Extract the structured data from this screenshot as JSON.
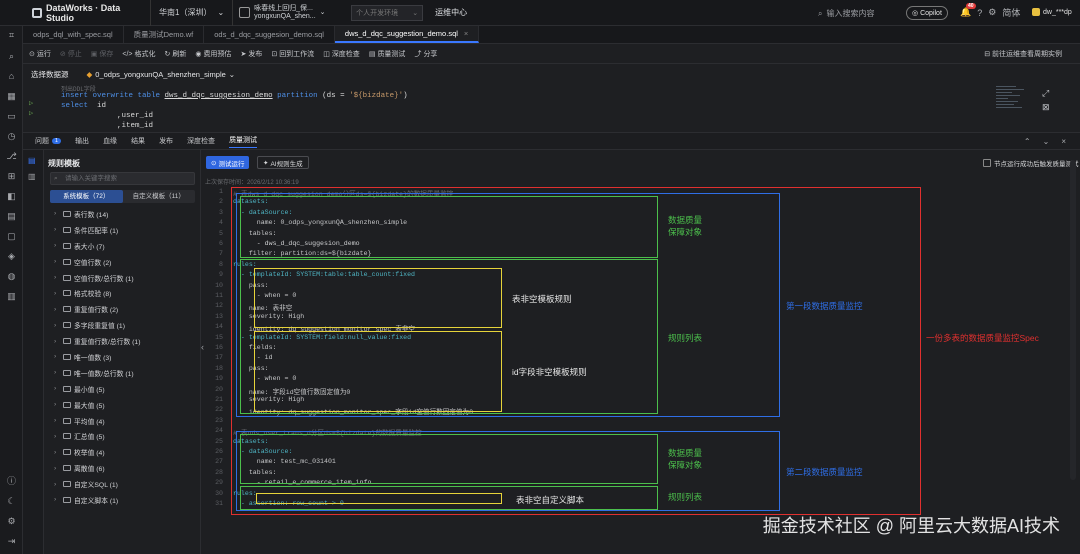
{
  "topbar": {
    "product": "DataWorks · Data Studio",
    "region": "华南1（深圳）",
    "workspace_l1": "咏春线上回归_保...",
    "workspace_l2": "yongxunQA_shen...",
    "env_placeholder": "个人开发环境",
    "op_center": "运维中心",
    "search_placeholder": "输入搜索内容",
    "copilot": "Copilot",
    "notif_count": "40",
    "lang": "简体",
    "user": "dw_***dp"
  },
  "tabs": [
    {
      "label": "odps_dql_with_spec.sql"
    },
    {
      "label": "质量测试Demo.wf"
    },
    {
      "label": "ods_d_dqc_suggesion_demo.sql"
    },
    {
      "label": "dws_d_dqc_suggestion_demo.sql",
      "active": true
    }
  ],
  "toolbar": {
    "items": [
      {
        "label": "运行",
        "icon": "play"
      },
      {
        "label": "停止",
        "dim": true
      },
      {
        "label": "保存",
        "dim": true
      },
      {
        "label": "</> 格式化"
      },
      {
        "label": "刷新"
      },
      {
        "label": "费用预估"
      },
      {
        "label": "发布"
      },
      {
        "label": "回到工作流"
      },
      {
        "label": "深度检查"
      },
      {
        "label": "质量测试"
      },
      {
        "label": "分享"
      }
    ],
    "right_link": "前往运维查看周期实例"
  },
  "datasource": {
    "label": "选择数据源",
    "value": "0_odps_yongxunQA_shenzhen_simple"
  },
  "editor": {
    "l0": "列出DDL字段",
    "l1a": "insert overwrite table",
    "l1b": "dws_d_dqc_suggesion_demo",
    "l1c": "partition",
    "l1d": "(ds =",
    "l1e": "'${bizdate}'",
    "l1f": ")",
    "l2a": "select",
    "l2b": "id",
    "l3": ",user_id",
    "l4": ",item_id"
  },
  "panel_tabs": [
    {
      "label": "问题",
      "count": "1"
    },
    {
      "label": "输出"
    },
    {
      "label": "血缘"
    },
    {
      "label": "结果"
    },
    {
      "label": "发布"
    },
    {
      "label": "深度检查"
    },
    {
      "label": "质量测试",
      "active": true
    }
  ],
  "templates": {
    "title": "规则模板",
    "search_placeholder": "请输入关键字搜索",
    "seg_system": "系统模板（72）",
    "seg_custom": "自定义模板（11）",
    "items": [
      "表行数 (14)",
      "条件匹配率 (1)",
      "表大小 (7)",
      "空值行数 (2)",
      "空值行数/总行数 (1)",
      "格式校验 (8)",
      "重复值行数 (2)",
      "多字段重复值 (1)",
      "重复值行数/总行数 (1)",
      "唯一值数 (3)",
      "唯一值数/总行数 (1)",
      "最小值 (5)",
      "最大值 (5)",
      "平均值 (4)",
      "汇总值 (5)",
      "枚举值 (4)",
      "离散值 (6)",
      "自定义SQL (1)",
      "自定义脚本 (1)"
    ]
  },
  "quality": {
    "run_btn": "测试运行",
    "ai_btn": "AI规则生成",
    "trigger_label": "节点运行成功后触发质量测试",
    "saved_at": "上次保存时间：2026/2/12 10:36:19"
  },
  "code_lines": [
    "# 表dws_d_dqc_suggesion_demo分区ds=${bizdate}的数据质量监控",
    "datasets:",
    "  - dataSource:",
    "      name: 0_odps_yongxunQA_shenzhen_simple",
    "    tables:",
    "      - dws_d_dqc_suggesion_demo",
    "    filter: partition:ds=${bizdate}",
    "rules:",
    "  - templateId: SYSTEM:table:table_count:fixed",
    "    pass:",
    "      - when = 0",
    "    name: 表非空",
    "    severity: High",
    "    identity: dq_suggestion_monitor_spec_表非空",
    "  - templateId: SYSTEM:field:null_value:fixed",
    "    fields:",
    "      - id",
    "    pass:",
    "      - when = 0",
    "    name: 字段id空值行数固定值为0",
    "    severity: High",
    "    identity: dq_suggestion_monitor_spec_字段id空值行数固定值为0",
    "",
    "# 表ods_user_trans_d分区ds=${bizdate}的数据质量监控",
    "datasets:",
    "  - dataSource:",
    "      name: test_mc_031401",
    "    tables:",
    "      - retail_e_commerce_item_info",
    "rules:",
    "  - assertion: row_count > 0"
  ],
  "annotations": {
    "target1": "数据质量\n保障对象",
    "tpl_rule": "表非空模板规则",
    "rule_list1": "规则列表",
    "id_rule": "id字段非空模板规则",
    "section1": "第一段数据质量监控",
    "spec": "一份多表的数据质量监控Spec",
    "target2": "数据质量\n保障对象",
    "section2": "第二段数据质量监控",
    "rule_list2": "规则列表",
    "custom_script": "表非空自定义脚本"
  },
  "colors": {
    "accent": "#3a78ff",
    "green": "#4cbf4c",
    "yellow": "#e6d33a",
    "blue": "#2f6ee6",
    "red": "#e0302f"
  },
  "watermark": "掘金技术社区 @ 阿里云大数据AI技术"
}
